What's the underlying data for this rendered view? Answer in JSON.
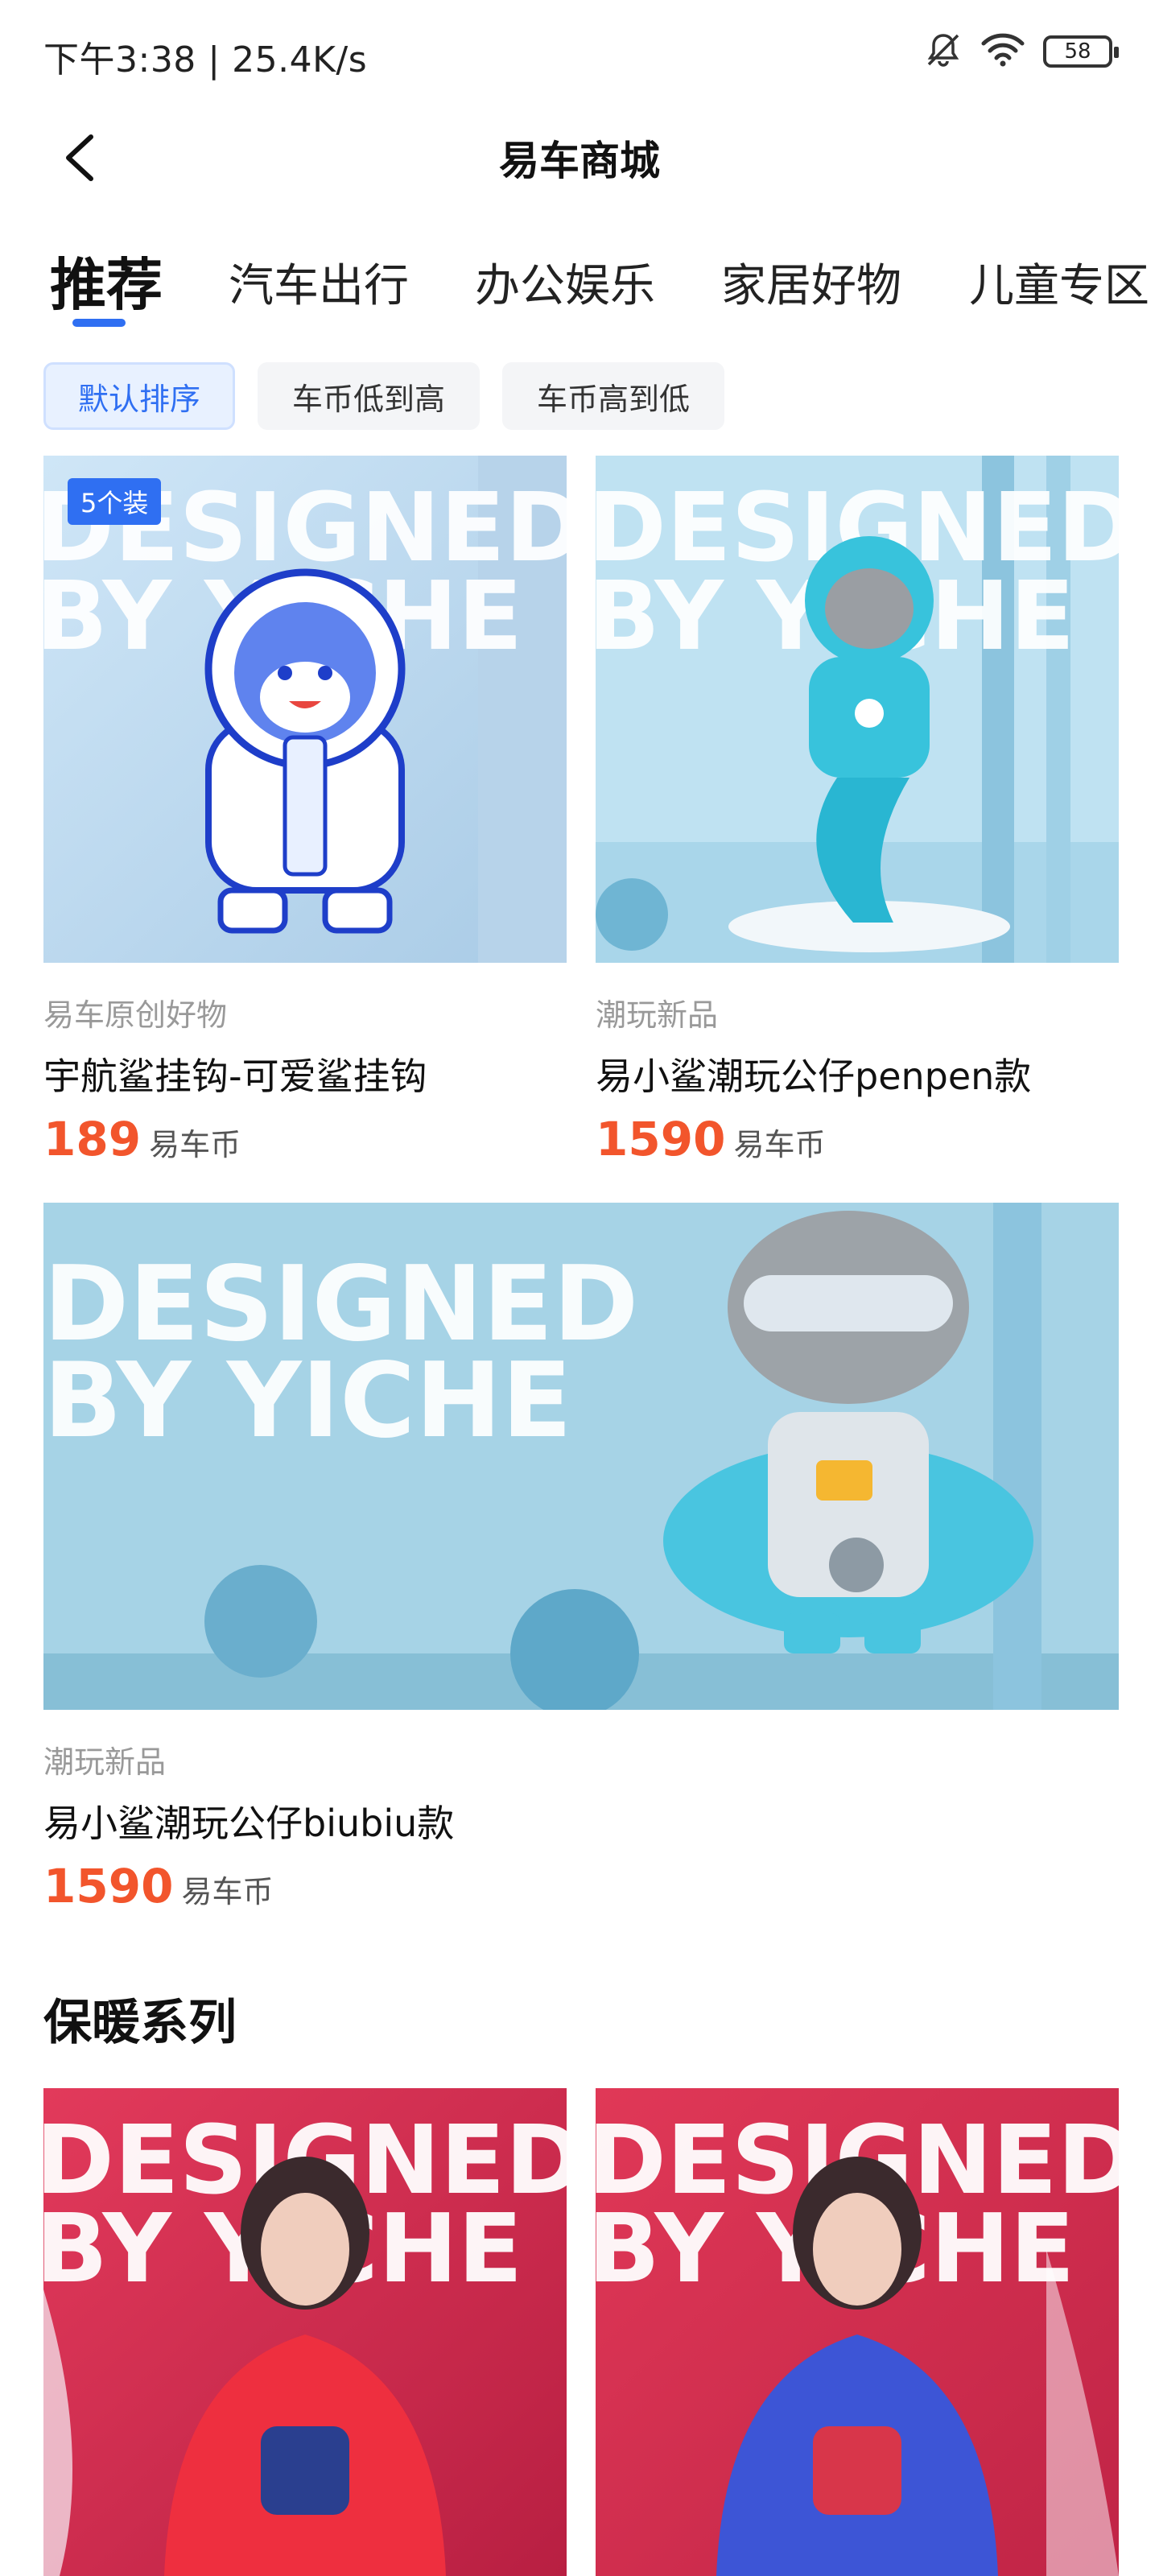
{
  "status_bar": {
    "time_speed": "下午3:38 | 25.4K/s",
    "icons": [
      "mute-bell-icon",
      "wifi-icon",
      "battery-icon"
    ],
    "battery_level": "58"
  },
  "nav": {
    "title": "易车商城",
    "back_icon": "chevron-left-icon"
  },
  "tabs": [
    {
      "label": "推荐",
      "active": true
    },
    {
      "label": "汽车出行",
      "active": false
    },
    {
      "label": "办公娱乐",
      "active": false
    },
    {
      "label": "家居好物",
      "active": false
    },
    {
      "label": "儿童专区",
      "active": false
    }
  ],
  "sort": [
    {
      "label": "默认排序",
      "active": true
    },
    {
      "label": "车币低到高",
      "active": false
    },
    {
      "label": "车币高到低",
      "active": false
    }
  ],
  "products": [
    {
      "badge": "5个装",
      "category": "易车原创好物",
      "title": "宇航鲨挂钩-可爱鲨挂钩",
      "price": "189",
      "unit": "易车币",
      "image_text": [
        "DESIGNED",
        "BY YICHE"
      ]
    },
    {
      "category": "潮玩新品",
      "title": "易小鲨潮玩公仔penpen款",
      "price": "1590",
      "unit": "易车币",
      "image_text": [
        "DESIGNED",
        "BY YICHE"
      ]
    },
    {
      "category": "潮玩新品",
      "title": "易小鲨潮玩公仔biubiu款",
      "price": "1590",
      "unit": "易车币",
      "image_text": [
        "DESIGNED",
        "BY YICHE"
      ]
    }
  ],
  "section": {
    "title": "保暖系列",
    "items": [
      {
        "image_text": [
          "DESIGNED",
          "BY YICHE"
        ]
      },
      {
        "image_text": [
          "DESIGNED",
          "BY YICHE"
        ]
      }
    ]
  },
  "colors": {
    "accent": "#2f6ff2",
    "price": "#f2552c",
    "toy_bg": "#a9d6ea",
    "warm_bg": "#d92a4c"
  }
}
